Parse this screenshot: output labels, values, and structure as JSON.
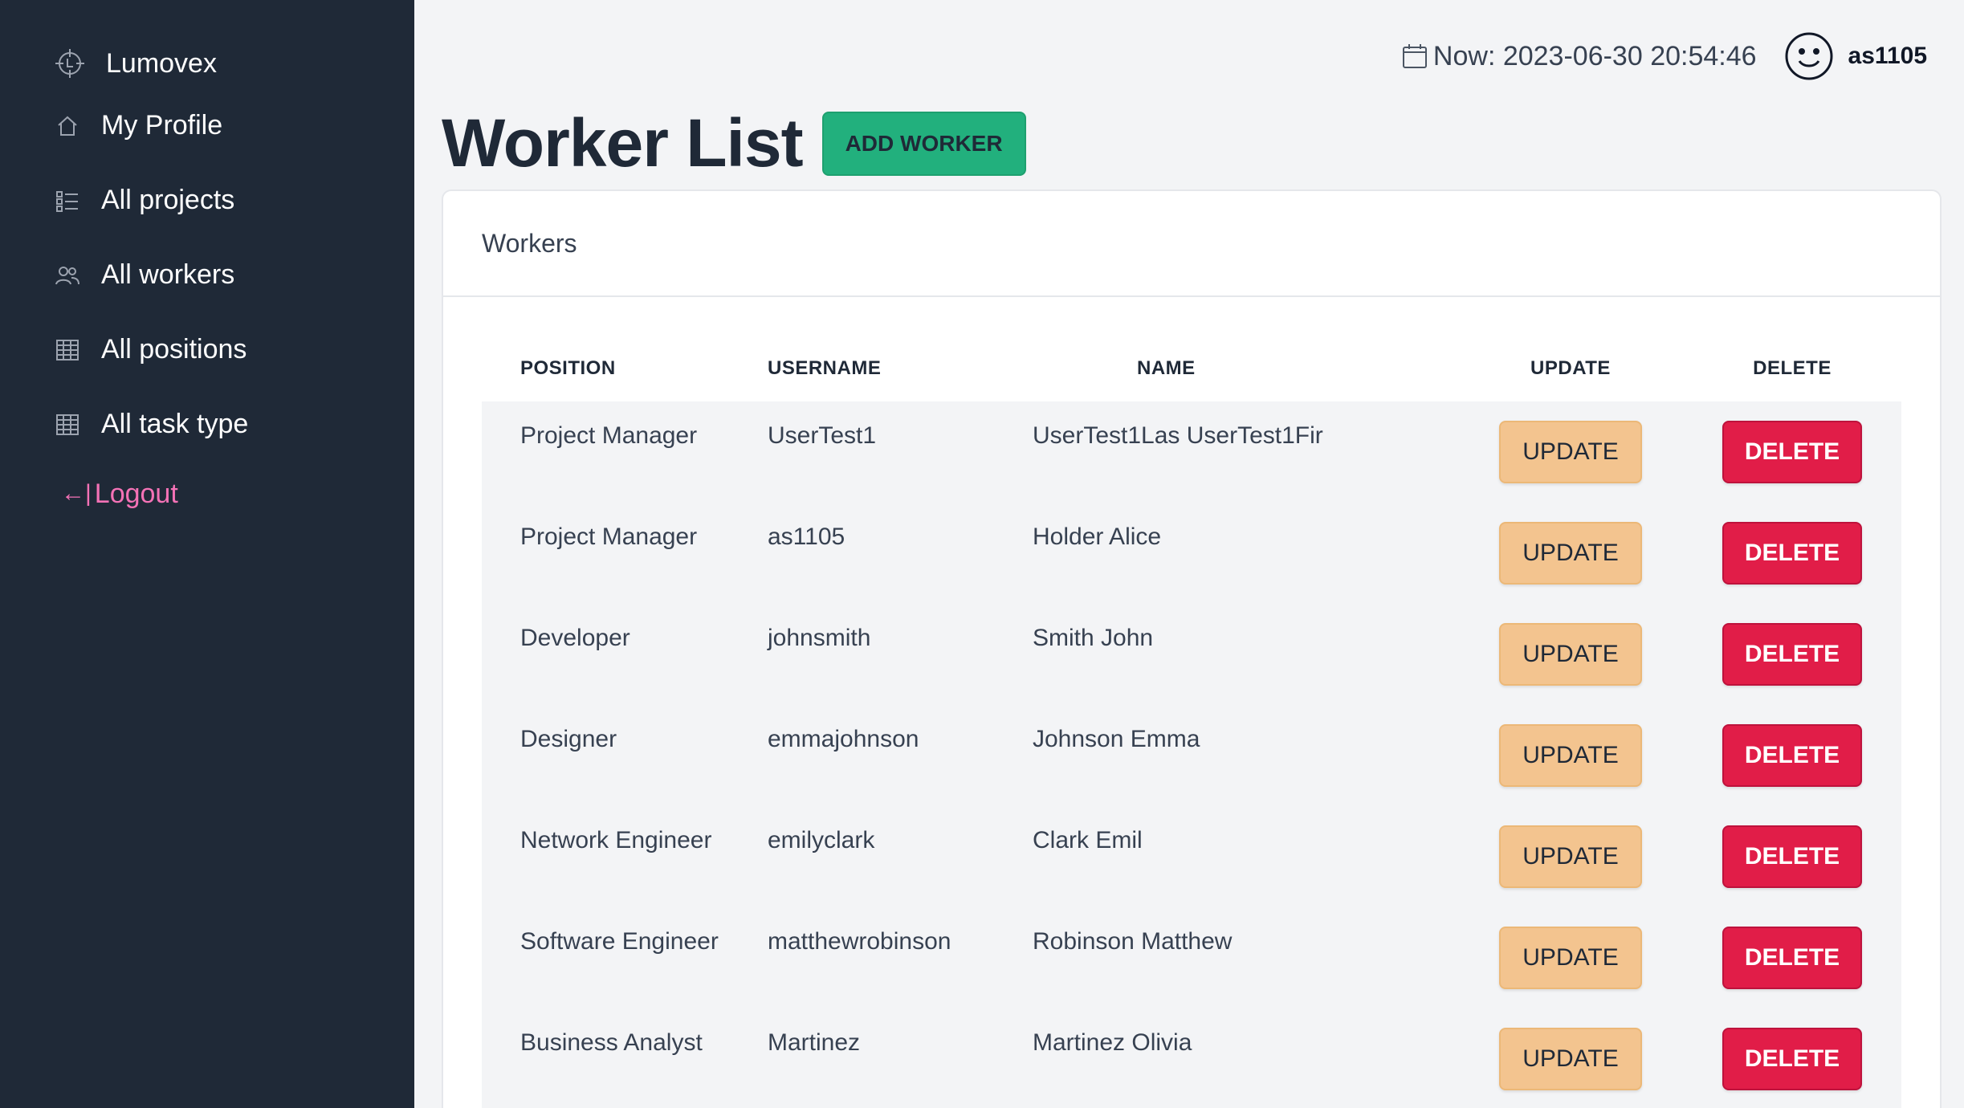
{
  "sidebar": {
    "brand": {
      "label": "Lumovex",
      "icon": "crosshair-logo-icon"
    },
    "items": [
      {
        "label": "My Profile",
        "icon": "home-icon"
      },
      {
        "label": "All projects",
        "icon": "checklist-icon"
      },
      {
        "label": "All workers",
        "icon": "users-icon"
      },
      {
        "label": "All positions",
        "icon": "table-icon"
      },
      {
        "label": "All task type",
        "icon": "table-icon"
      }
    ],
    "logout": {
      "label": "Logout",
      "icon": "logout-arrow-icon",
      "color": "#f472b6"
    }
  },
  "topbar": {
    "clock_text": "Now: 2023-06-30 20:54:46",
    "username": "as1105"
  },
  "page": {
    "title": "Worker List",
    "add_button": "ADD WORKER"
  },
  "card": {
    "title": "Workers",
    "columns": [
      "POSITION",
      "USERNAME",
      "NAME",
      "UPDATE",
      "DELETE"
    ],
    "rows": [
      {
        "position": "Project Manager",
        "username": "UserTest1",
        "name": "UserTest1Las UserTest1Fir",
        "update": "UPDATE",
        "delete": "DELETE"
      },
      {
        "position": "Project Manager",
        "username": "as1105",
        "name": "Holder Alice",
        "update": "UPDATE",
        "delete": "DELETE"
      },
      {
        "position": "Developer",
        "username": "johnsmith",
        "name": "Smith John",
        "update": "UPDATE",
        "delete": "DELETE"
      },
      {
        "position": "Designer",
        "username": "emmajohnson",
        "name": "Johnson Emma",
        "update": "UPDATE",
        "delete": "DELETE"
      },
      {
        "position": "Network Engineer",
        "username": "emilyclark",
        "name": "Clark Emil",
        "update": "UPDATE",
        "delete": "DELETE"
      },
      {
        "position": "Software Engineer",
        "username": "matthewrobinson",
        "name": "Robinson Matthew",
        "update": "UPDATE",
        "delete": "DELETE"
      },
      {
        "position": "Business Analyst",
        "username": "Martinez",
        "name": "Martinez Olivia",
        "update": "UPDATE",
        "delete": "DELETE"
      }
    ]
  },
  "colors": {
    "sidebar_bg": "#1f2937",
    "add_button": "#22b07d",
    "update_button": "#f3c48f",
    "delete_button": "#e11d48"
  }
}
